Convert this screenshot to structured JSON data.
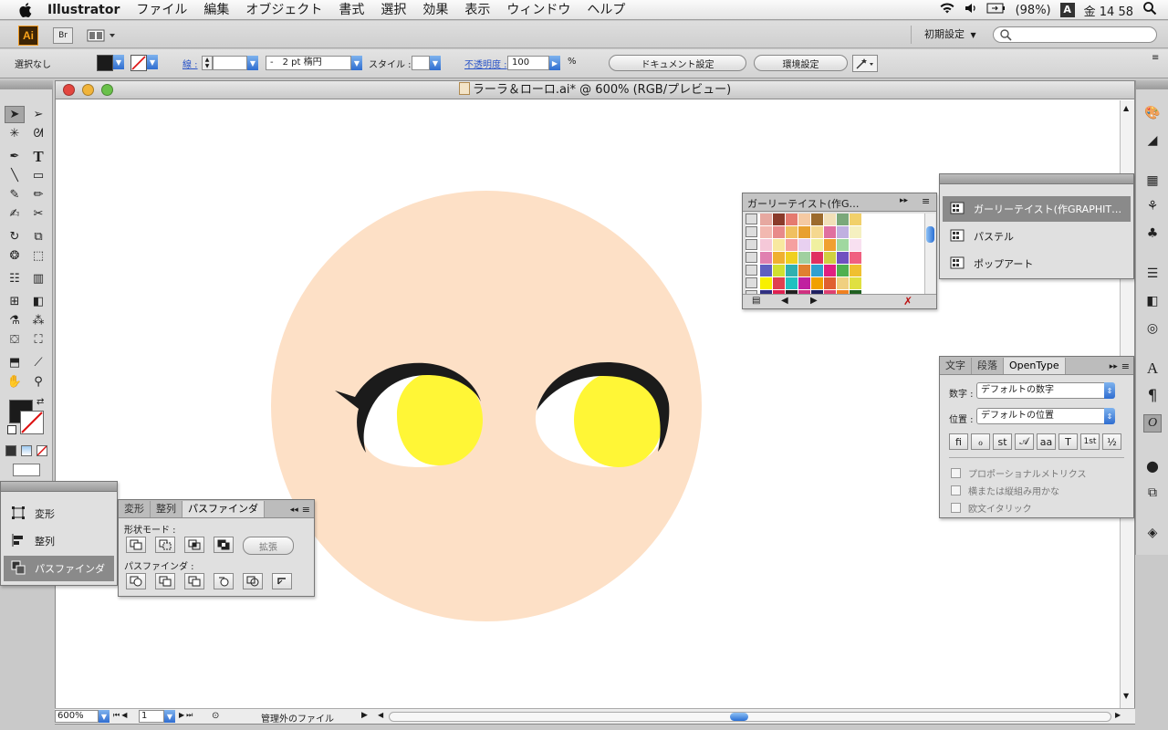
{
  "menubar": {
    "app_name": "Illustrator",
    "items": [
      "ファイル",
      "編集",
      "オブジェクト",
      "書式",
      "選択",
      "効果",
      "表示",
      "ウィンドウ",
      "ヘルプ"
    ],
    "battery": "(98%)",
    "input_indicator": "A",
    "clock": "金 14 58"
  },
  "appbar": {
    "logo": "Ai",
    "bridge": "Br",
    "workspace": "初期設定"
  },
  "control": {
    "selection": "選択なし",
    "stroke_label": "線 :",
    "brush": "2 pt 楕円",
    "brush_prefix": "-",
    "style_label": "スタイル :",
    "opacity_label": "不透明度 :",
    "opacity_value": "100",
    "opacity_unit": "%",
    "doc_setup": "ドキュメント設定",
    "prefs": "環境設定"
  },
  "document": {
    "title": "ラーラ＆ローロ.ai* @ 600% (RGB/プレビュー)",
    "zoom": "600%",
    "page": "1",
    "status": "管理外のファイル"
  },
  "swatch_panel": {
    "title": "ガーリーテイスト(作G…",
    "rows": [
      [
        "#e6a8a0",
        "#8a3a2a",
        "#e57a6f",
        "#f5c9a2",
        "#9c6b2e",
        "#f2e0b8",
        "#7aa87a",
        "#f1d06a"
      ],
      [
        "#f2b8b0",
        "#e88a8a",
        "#f0c060",
        "#e8a030",
        "#f5d890",
        "#e070a0",
        "#c0b0e0",
        "#f5f0c0"
      ],
      [
        "#f5c8d8",
        "#f8e8a0",
        "#f5a0a0",
        "#e8d0f0",
        "#f0f0a0",
        "#f0a030",
        "#a0d8a0",
        "#f8e0f0"
      ],
      [
        "#e080b0",
        "#f0b030",
        "#f0d020",
        "#a0d0a0",
        "#e03060",
        "#d0d040",
        "#7050c0",
        "#f06080"
      ],
      [
        "#6060c0",
        "#d0e030",
        "#30b0b0",
        "#e08030",
        "#30a0d0",
        "#e02080",
        "#50b050",
        "#f0c030"
      ],
      [
        "#f8f000",
        "#e04050",
        "#20c0c0",
        "#c020a0",
        "#f0a000",
        "#e06030",
        "#f0d080",
        "#e0e040"
      ],
      [
        "#303080",
        "#e02050",
        "#202020",
        "#d03080",
        "#202060",
        "#e04070",
        "#f08020",
        "#206020"
      ]
    ]
  },
  "library_panel": {
    "items": [
      "ガーリーテイスト(作GRAPHIT…",
      "パステル",
      "ポップアート"
    ]
  },
  "char_panel": {
    "tabs": [
      "文字",
      "段落",
      "OpenType"
    ],
    "figure_label": "数字 :",
    "figure_value": "デフォルトの数字",
    "position_label": "位置 :",
    "position_value": "デフォルトの位置",
    "glyphs": [
      "fi",
      "ℴ",
      "st",
      "𝒜",
      "aa",
      "T",
      "1st",
      "½"
    ],
    "options": [
      "プロポーショナルメトリクス",
      "横または縦組み用かな",
      "欧文イタリック"
    ]
  },
  "align_group_panel": {
    "items": [
      "変形",
      "整列",
      "パスファインダ"
    ]
  },
  "pathfinder_panel": {
    "tabs": [
      "変形",
      "整列",
      "パスファインダ"
    ],
    "shape_mode_label": "形状モード :",
    "expand": "拡張",
    "pathfinder_label": "パスファインダ :"
  },
  "colors": {
    "face": "#fde0c6",
    "eye_yellow": "#fff636",
    "lash": "#1b1b1b",
    "accent_blue": "#2f6dd0"
  }
}
